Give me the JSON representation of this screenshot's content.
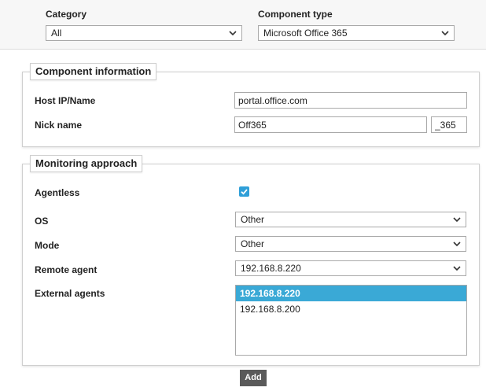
{
  "top": {
    "category_label": "Category",
    "category_value": "All",
    "component_type_label": "Component type",
    "component_type_value": "Microsoft Office 365"
  },
  "component_info": {
    "legend": "Component information",
    "host_label": "Host IP/Name",
    "host_value": "portal.office.com",
    "nick_label": "Nick name",
    "nick_value": "Off365",
    "nick_suffix": "_365"
  },
  "monitoring": {
    "legend": "Monitoring approach",
    "agentless_label": "Agentless",
    "agentless_checked": true,
    "os_label": "OS",
    "os_value": "Other",
    "mode_label": "Mode",
    "mode_value": "Other",
    "remote_agent_label": "Remote agent",
    "remote_agent_value": "192.168.8.220",
    "external_agents_label": "External agents",
    "external_agents": [
      {
        "label": "192.168.8.220",
        "selected": true
      },
      {
        "label": "192.168.8.200",
        "selected": false
      }
    ]
  },
  "actions": {
    "add_label": "Add"
  },
  "colors": {
    "accent": "#3aa9d6",
    "checkbox": "#2f9fd8",
    "button": "#5a5a5a"
  }
}
